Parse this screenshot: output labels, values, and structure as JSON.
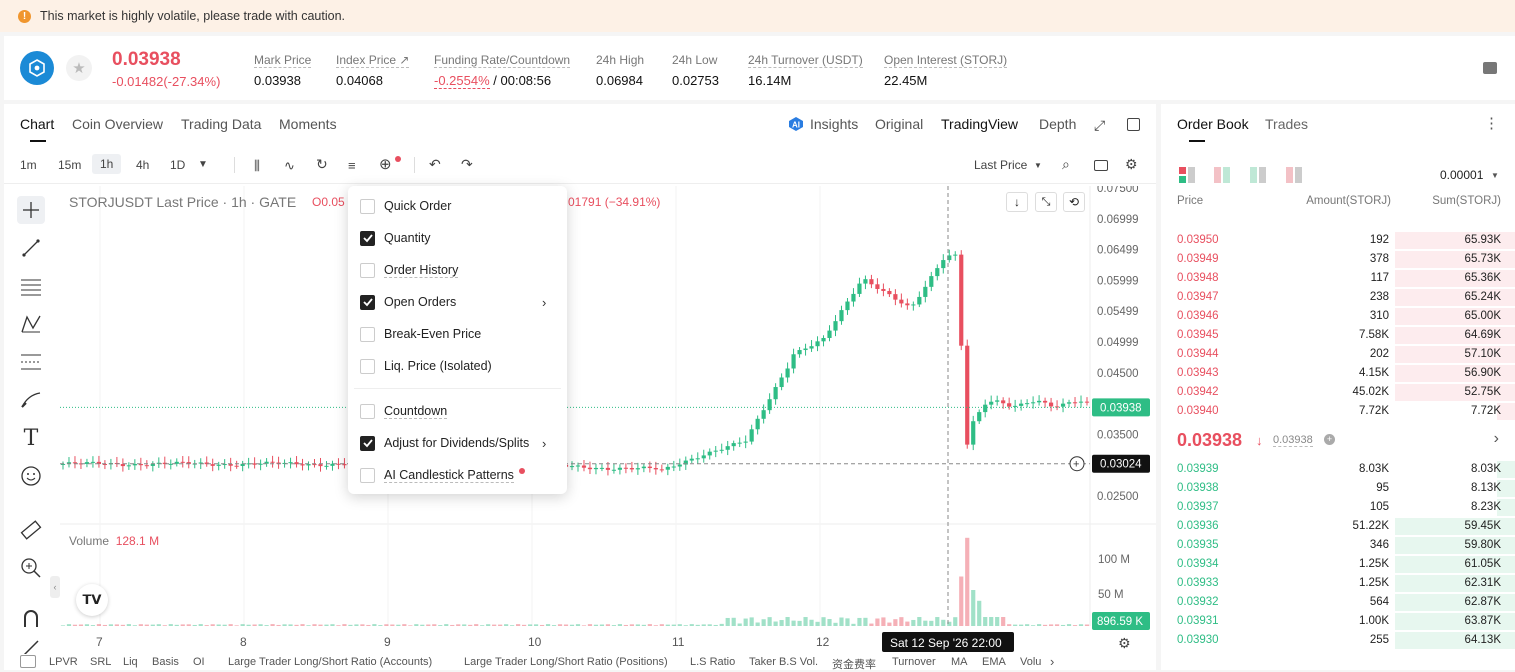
{
  "banner": {
    "icon": "warning-icon",
    "text": "This market is highly volatile, please trade with caution."
  },
  "ticker": {
    "coin_icon": "storj-logo",
    "price": "0.03938",
    "change": "-0.01482(-27.34%)",
    "mark_label": "Mark Price",
    "mark_value": "0.03938",
    "index_label": "Index Price ↗",
    "index_value": "0.04068",
    "funding_label": "Funding Rate/Countdown",
    "funding_rate": "-0.2554%",
    "funding_countdown": "/ 00:08:56",
    "high_label": "24h High",
    "high_value": "0.06984",
    "low_label": "24h Low",
    "low_value": "0.02753",
    "turnover_label": "24h Turnover (USDT)",
    "turnover_value": "16.14M",
    "oi_label": "Open Interest (STORJ)",
    "oi_value": "22.45M"
  },
  "chart_tabs": [
    "Chart",
    "Coin Overview",
    "Trading Data",
    "Moments"
  ],
  "view_tabs": {
    "insights": "Insights",
    "original": "Original",
    "tradingview": "TradingView",
    "depth": "Depth"
  },
  "intervals": [
    "1m",
    "15m",
    "1h",
    "4h",
    "1D"
  ],
  "last_price_select": "Last Price",
  "chart_header": {
    "symbol": "STORJUSDT Last Price · 1h · GATE",
    "ohlc_left": "O0.05",
    "ohlc_right": "01791 (−34.91%)"
  },
  "price_axis": [
    "0.07500",
    "0.06999",
    "0.06499",
    "0.05999",
    "0.05499",
    "0.04999",
    "0.04500",
    "0.03500",
    "0.02500"
  ],
  "last_price_tag": "0.03938",
  "cursor_price_tag": "0.03024",
  "volume_label": "Volume",
  "volume_value": "128.1 M",
  "volume_axis": [
    "100 M",
    "50 M"
  ],
  "volume_tag": "896.59 K",
  "time_axis": [
    "7",
    "8",
    "9",
    "10",
    "11",
    "12"
  ],
  "cursor_time": "Sat 12 Sep '26   22:00",
  "menu": [
    {
      "label": "Quick Order",
      "checked": false,
      "arrow": false
    },
    {
      "label": "Quantity",
      "checked": true,
      "arrow": false
    },
    {
      "label": "Order History",
      "checked": false,
      "arrow": false
    },
    {
      "label": "Open Orders",
      "checked": true,
      "arrow": true
    },
    {
      "label": "Break-Even Price",
      "checked": false,
      "arrow": false
    },
    {
      "label": "Liq. Price (Isolated)",
      "checked": false,
      "arrow": false
    },
    {
      "label": "Countdown",
      "checked": false,
      "arrow": false
    },
    {
      "label": "Adjust for Dividends/Splits",
      "checked": true,
      "arrow": true
    },
    {
      "label": "AI Candlestick Patterns",
      "checked": false,
      "arrow": false
    }
  ],
  "orderbook": {
    "tabs": [
      "Order Book",
      "Trades"
    ],
    "precision": "0.00001",
    "headers": [
      "Price",
      "Amount(STORJ)",
      "Sum(STORJ)"
    ],
    "asks": [
      [
        "0.03950",
        "192",
        "65.93K",
        0.34
      ],
      [
        "0.03949",
        "378",
        "65.73K",
        0.34
      ],
      [
        "0.03948",
        "117",
        "65.36K",
        0.34
      ],
      [
        "0.03947",
        "238",
        "65.24K",
        0.34
      ],
      [
        "0.03946",
        "310",
        "65.00K",
        0.34
      ],
      [
        "0.03945",
        "7.58K",
        "64.69K",
        0.34
      ],
      [
        "0.03944",
        "202",
        "57.10K",
        0.34
      ],
      [
        "0.03943",
        "4.15K",
        "56.90K",
        0.34
      ],
      [
        "0.03942",
        "45.02K",
        "52.75K",
        0.34
      ],
      [
        "0.03940",
        "7.72K",
        "7.72K",
        0.05
      ]
    ],
    "mid_price": "0.03938",
    "mid_mark": "0.03938",
    "bids": [
      [
        "0.03939",
        "8.03K",
        "8.03K",
        0.05
      ],
      [
        "0.03938",
        "95",
        "8.13K",
        0.05
      ],
      [
        "0.03937",
        "105",
        "8.23K",
        0.05
      ],
      [
        "0.03936",
        "51.22K",
        "59.45K",
        0.34
      ],
      [
        "0.03935",
        "346",
        "59.80K",
        0.34
      ],
      [
        "0.03934",
        "1.25K",
        "61.05K",
        0.34
      ],
      [
        "0.03933",
        "1.25K",
        "62.31K",
        0.34
      ],
      [
        "0.03932",
        "564",
        "62.87K",
        0.34
      ],
      [
        "0.03931",
        "1.00K",
        "63.87K",
        0.34
      ],
      [
        "0.03930",
        "255",
        "64.13K",
        0.34
      ]
    ]
  },
  "bottom_tabs": [
    "LPVR",
    "SRL",
    "Liq",
    "Basis",
    "OI",
    "Large Trader Long/Short Ratio (Accounts)",
    "Large Trader Long/Short Ratio (Positions)",
    "L.S Ratio",
    "Taker B.S Vol.",
    "资金费率",
    "Turnover",
    "MA",
    "EMA",
    "Volu"
  ],
  "colors": {
    "up": "#2ebd85",
    "down": "#e84f5f",
    "accent": "#f0962e"
  }
}
